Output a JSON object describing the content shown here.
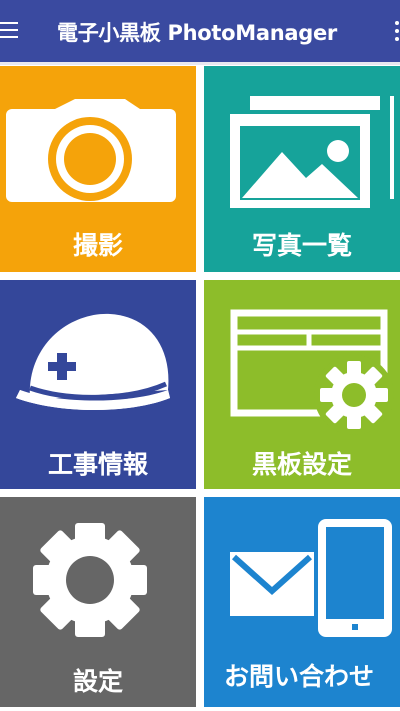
{
  "appbar": {
    "title": "電子小黒板 PhotoManager",
    "menu_icon": "hamburger-menu-icon",
    "overflow_icon": "overflow-menu-icon"
  },
  "tiles": [
    {
      "label": "撮影",
      "icon": "camera-icon",
      "color": "#f5a30a"
    },
    {
      "label": "写真一覧",
      "icon": "photo-gallery-icon",
      "color": "#16a39a"
    },
    {
      "label": "工事情報",
      "icon": "hard-hat-icon",
      "color": "#34479a"
    },
    {
      "label": "黒板設定",
      "icon": "blackboard-settings-icon",
      "color": "#8dbd2a"
    },
    {
      "label": "設定",
      "icon": "gear-icon",
      "color": "#666666"
    },
    {
      "label": "お問い合わせ",
      "icon": "contact-mail-phone-icon",
      "color": "#1d84cf"
    }
  ]
}
